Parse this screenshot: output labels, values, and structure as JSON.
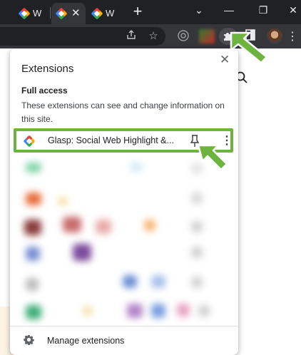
{
  "browser": {
    "tabs": [
      {
        "title": "W",
        "active": false
      },
      {
        "title": "W",
        "active": true
      },
      {
        "title": "W",
        "active": false
      }
    ],
    "new_tab_icon": "+",
    "window_controls": {
      "tabsearch": "⌄",
      "minimize": "—",
      "restore": "❐",
      "close": "✕"
    },
    "toolbar_icons": [
      "share-icon",
      "star-icon",
      "camera-icon",
      "extensions-icon",
      "side-panel-icon",
      "profile-avatar",
      "menu-icon"
    ]
  },
  "popup": {
    "title": "Extensions",
    "close_icon": "✕",
    "section_title": "Full access",
    "section_description": "These extensions can see and change information on this site.",
    "extensions": [
      {
        "name": "Glasp: Social Web Highlight &...",
        "pinned": false
      }
    ],
    "manage_label": "Manage extensions"
  },
  "colors": {
    "highlight": "#6db33f",
    "chrome_dark": "#202124",
    "toolbar": "#35363a"
  }
}
